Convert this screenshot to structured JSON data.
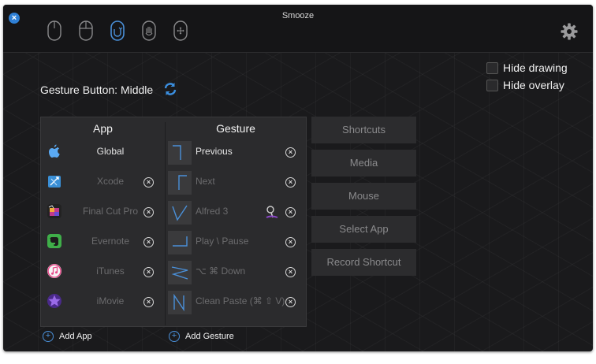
{
  "window": {
    "title": "Smooze"
  },
  "toolbar": {
    "modes": [
      {
        "name": "left-click-mouse-icon",
        "active": false
      },
      {
        "name": "both-buttons-mouse-icon",
        "active": false
      },
      {
        "name": "gesture-mouse-icon",
        "active": true
      },
      {
        "name": "hand-mouse-icon",
        "active": false
      },
      {
        "name": "move-mouse-icon",
        "active": false
      }
    ],
    "settings_icon": "gear-icon"
  },
  "gesture_button": {
    "label": "Gesture Button: Middle",
    "icon": "refresh-icon"
  },
  "options": {
    "hide_drawing": "Hide drawing",
    "hide_overlay": "Hide overlay"
  },
  "table": {
    "headers": {
      "app": "App",
      "gesture": "Gesture"
    },
    "apps": [
      {
        "label": "Global",
        "icon": "apple-icon",
        "color": "#5aa9f2",
        "active": true,
        "removable": false
      },
      {
        "label": "Xcode",
        "icon": "xcode-icon",
        "color": "#3a8fd6",
        "active": false,
        "removable": true
      },
      {
        "label": "Final Cut Pro",
        "icon": "final-cut-pro-icon",
        "color": "#c23a8c",
        "active": false,
        "removable": true
      },
      {
        "label": "Evernote",
        "icon": "evernote-icon",
        "color": "#3fae49",
        "active": false,
        "removable": true
      },
      {
        "label": "iTunes",
        "icon": "itunes-icon",
        "color": "#e64a8a",
        "active": false,
        "removable": true
      },
      {
        "label": "iMovie",
        "icon": "imovie-icon",
        "color": "#7a45c8",
        "active": false,
        "removable": true
      }
    ],
    "gestures": [
      {
        "label": "Previous",
        "active": true
      },
      {
        "label": "Next",
        "active": false
      },
      {
        "label": "Alfred 3",
        "active": false,
        "app_icon": "alfred-icon"
      },
      {
        "label": "Play \\ Pause",
        "active": false
      },
      {
        "label": "⌥ ⌘ Down",
        "active": false
      },
      {
        "label": "Clean Paste (⌘ ⇧ V)",
        "active": false
      }
    ],
    "add_app": "Add App",
    "add_gesture": "Add Gesture"
  },
  "actions": [
    "Shortcuts",
    "Media",
    "Mouse",
    "Select App",
    "Record Shortcut"
  ],
  "colors": {
    "accent": "#4a90d9",
    "background": "#1a1a1c",
    "panel": "#2b2b2d"
  }
}
